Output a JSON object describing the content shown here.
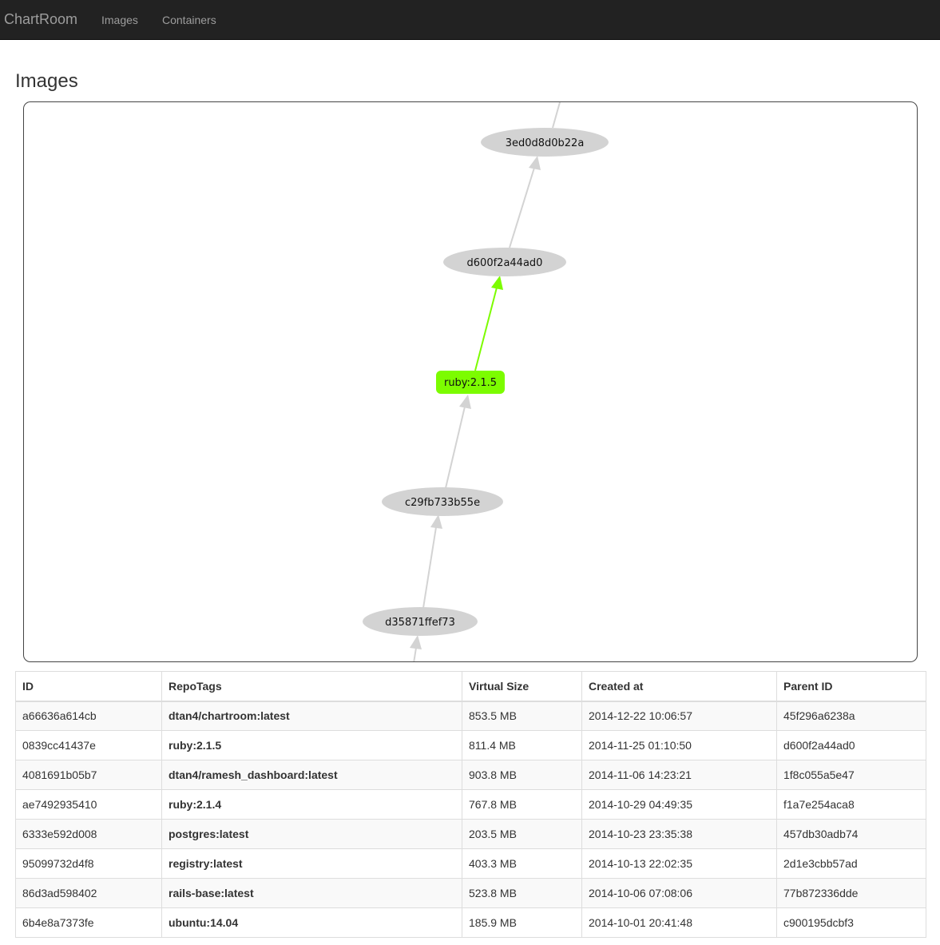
{
  "nav": {
    "brand": "ChartRoom",
    "links": [
      "Images",
      "Containers"
    ]
  },
  "page": {
    "title": "Images"
  },
  "graph": {
    "highlight_color": "#7cfc00",
    "node_color": "#d3d3d3",
    "nodes": [
      {
        "label": "3ed0d8d0b22a",
        "highlighted": false
      },
      {
        "label": "d600f2a44ad0",
        "highlighted": false
      },
      {
        "label": "ruby:2.1.5",
        "highlighted": true
      },
      {
        "label": "c29fb733b55e",
        "highlighted": false
      },
      {
        "label": "d35871ffef73",
        "highlighted": false
      }
    ]
  },
  "table": {
    "headers": [
      "ID",
      "RepoTags",
      "Virtual Size",
      "Created at",
      "Parent ID"
    ],
    "rows": [
      [
        "a66636a614cb",
        "dtan4/chartroom:latest",
        "853.5 MB",
        "2014-12-22 10:06:57",
        "45f296a6238a"
      ],
      [
        "0839cc41437e",
        "ruby:2.1.5",
        "811.4 MB",
        "2014-11-25 01:10:50",
        "d600f2a44ad0"
      ],
      [
        "4081691b05b7",
        "dtan4/ramesh_dashboard:latest",
        "903.8 MB",
        "2014-11-06 14:23:21",
        "1f8c055a5e47"
      ],
      [
        "ae7492935410",
        "ruby:2.1.4",
        "767.8 MB",
        "2014-10-29 04:49:35",
        "f1a7e254aca8"
      ],
      [
        "6333e592d008",
        "postgres:latest",
        "203.5 MB",
        "2014-10-23 23:35:38",
        "457db30adb74"
      ],
      [
        "95099732d4f8",
        "registry:latest",
        "403.3 MB",
        "2014-10-13 22:02:35",
        "2d1e3cbb57ad"
      ],
      [
        "86d3ad598402",
        "rails-base:latest",
        "523.8 MB",
        "2014-10-06 07:08:06",
        "77b872336dde"
      ],
      [
        "6b4e8a7373fe",
        "ubuntu:14.04",
        "185.9 MB",
        "2014-10-01 20:41:48",
        "c900195dcbf3"
      ]
    ]
  }
}
